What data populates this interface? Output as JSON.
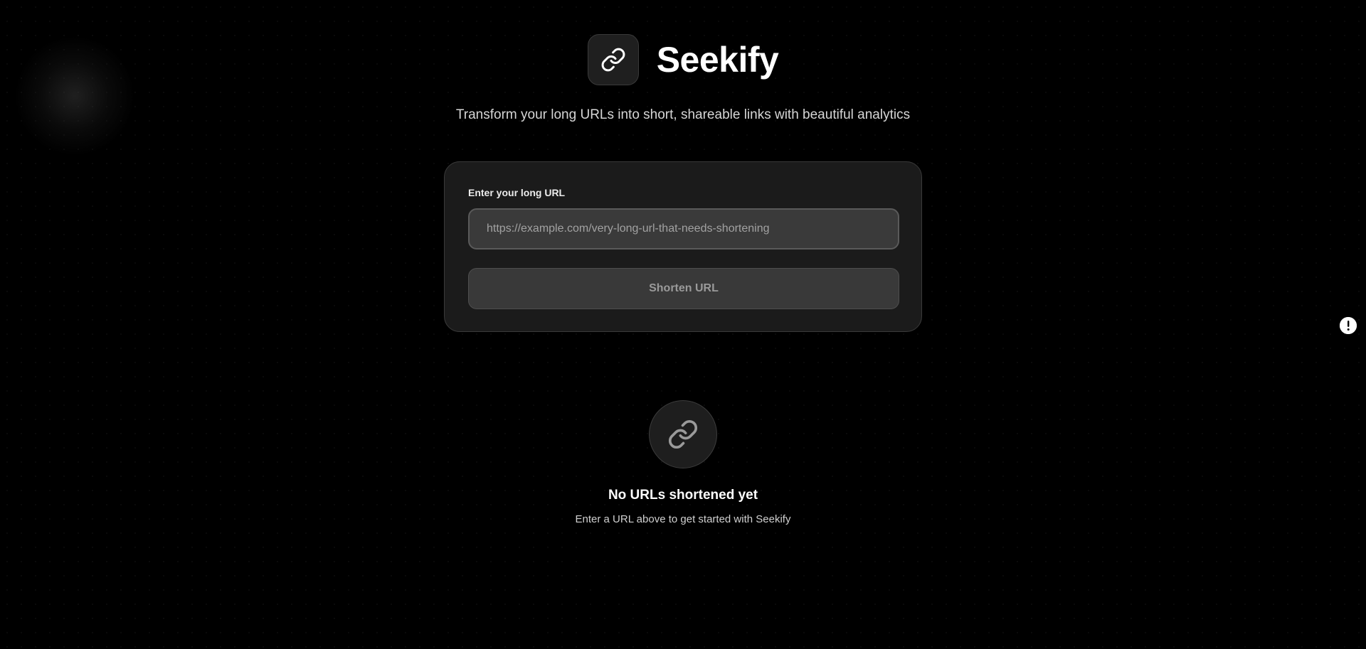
{
  "header": {
    "brand": "Seekify",
    "logo_icon": "link-icon",
    "tagline": "Transform your long URLs into short, shareable links with beautiful analytics"
  },
  "form": {
    "label": "Enter your long URL",
    "input_placeholder": "https://example.com/very-long-url-that-needs-shortening",
    "input_value": "",
    "submit_label": "Shorten URL"
  },
  "empty_state": {
    "icon": "link-icon",
    "title": "No URLs shortened yet",
    "subtitle": "Enter a URL above to get started with Seekify"
  },
  "floating": {
    "icon": "feedback-icon"
  },
  "colors": {
    "background": "#000000",
    "card": "#1b1b1b",
    "input": "#3a3a3a",
    "button": "#393939"
  }
}
